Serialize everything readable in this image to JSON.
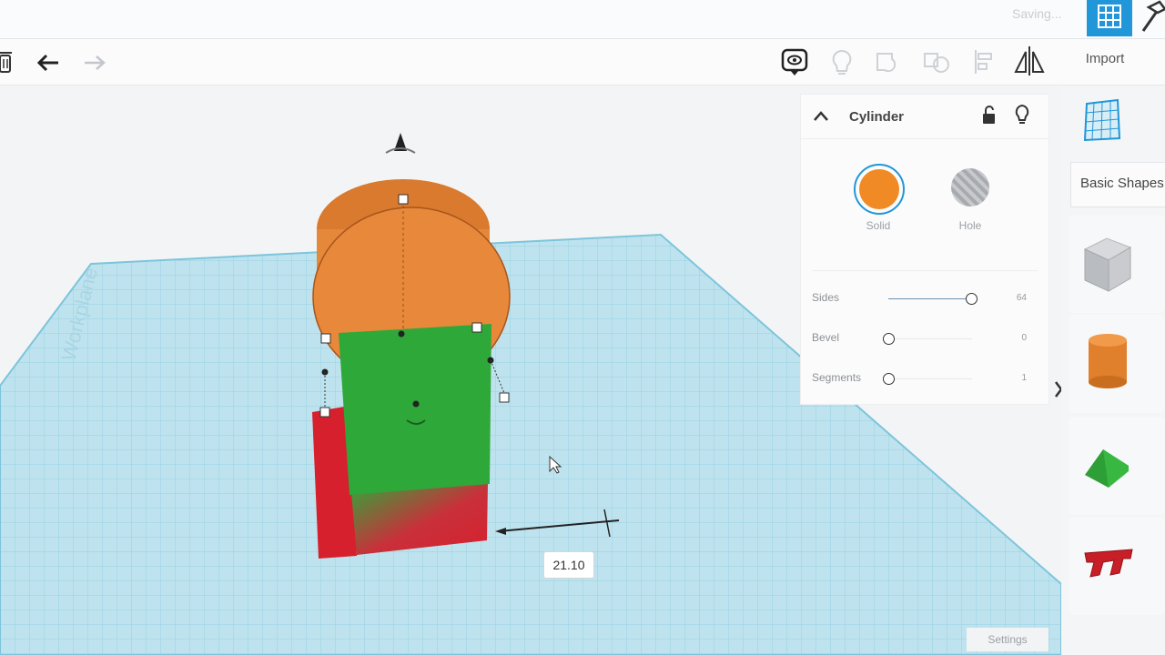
{
  "topbar": {
    "status": "Saving..."
  },
  "toolbar": {
    "import_label": "Import"
  },
  "inspector": {
    "title": "Cylinder",
    "solid_label": "Solid",
    "hole_label": "Hole",
    "solid_color": "#f08a24",
    "params": [
      {
        "label": "Sides",
        "value": "64"
      },
      {
        "label": "Bevel",
        "value": "0"
      },
      {
        "label": "Segments",
        "value": "1"
      }
    ]
  },
  "sidebar": {
    "category": "Basic Shapes",
    "settings_label": "Settings"
  },
  "viewport": {
    "workplane_label": "Workplane",
    "dimension_value": "21.10",
    "colors": {
      "workplane": "#bfe3ee",
      "box": "#d6202e",
      "roof": "#2fa83a",
      "cylinder": "#e7883b",
      "accent": "#2196d8"
    }
  }
}
